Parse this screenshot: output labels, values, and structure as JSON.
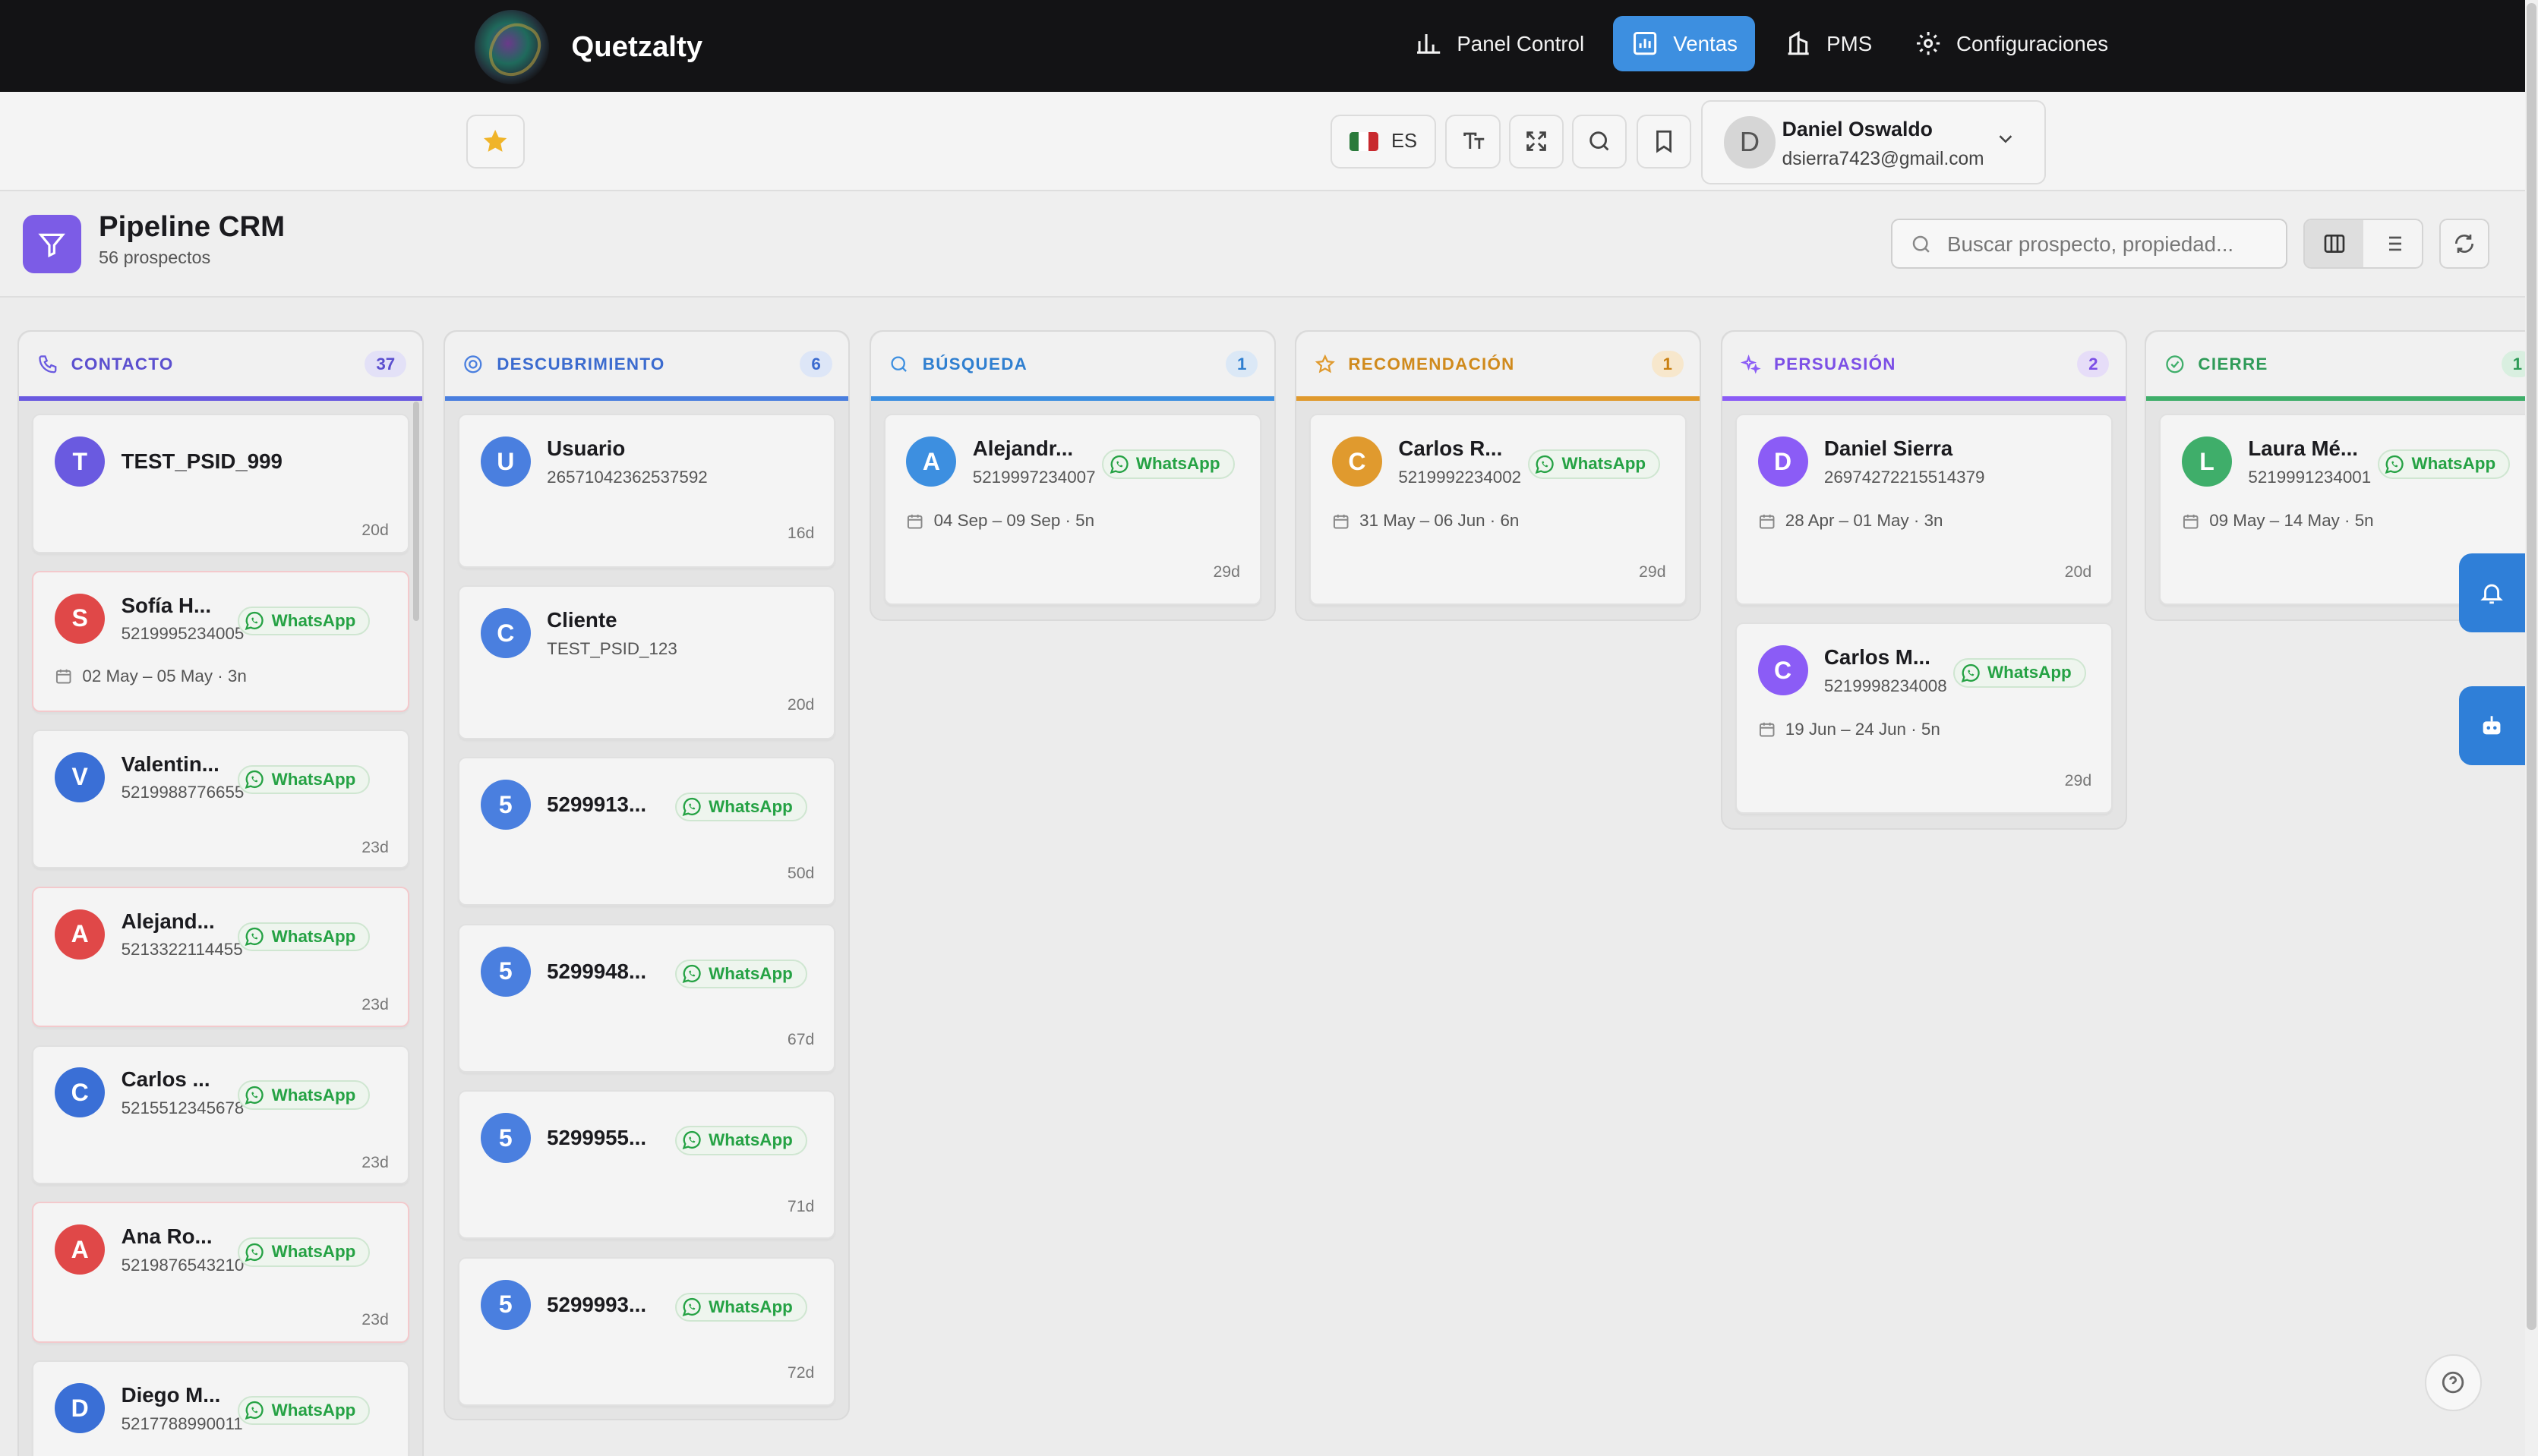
{
  "app": {
    "name": "Quetzalty"
  },
  "nav": [
    {
      "label": "Panel Control",
      "icon": "bar-chart-icon",
      "active": false
    },
    {
      "label": "Ventas",
      "icon": "sales-chart-icon",
      "active": true
    },
    {
      "label": "PMS",
      "icon": "building-icon",
      "active": false
    },
    {
      "label": "Configuraciones",
      "icon": "gear-icon",
      "active": false
    }
  ],
  "toolbar": {
    "language": "ES"
  },
  "user": {
    "initial": "D",
    "name": "Daniel Oswaldo",
    "email": "dsierra7423@gmail.com"
  },
  "page": {
    "title": "Pipeline CRM",
    "subtitle": "56 prospectos"
  },
  "search": {
    "placeholder": "Buscar prospecto, propiedad...",
    "value": ""
  },
  "colors": {
    "accent": "#3d8fe0",
    "brand": "#7c5ce6",
    "whatsapp": "#25a244"
  },
  "columns": [
    {
      "title": "CONTACTO",
      "count": "37",
      "color": "#6a5ae0",
      "icon": "phone-icon"
    },
    {
      "title": "DESCUBRIMIENTO",
      "count": "6",
      "color": "#4a7fdf",
      "icon": "target-icon"
    },
    {
      "title": "BÚSQUEDA",
      "count": "1",
      "color": "#3d8fe0",
      "icon": "search-icon"
    },
    {
      "title": "RECOMENDACIÓN",
      "count": "1",
      "color": "#e09a2e",
      "icon": "star-icon"
    },
    {
      "title": "PERSUASIÓN",
      "count": "2",
      "color": "#8b5cf6",
      "icon": "sparkle-icon"
    },
    {
      "title": "CIERRE",
      "count": "1",
      "color": "#3fae6a",
      "icon": "check-circle-icon"
    }
  ],
  "cards": {
    "contacto": [
      {
        "initial": "T",
        "name": "TEST_PSID_999",
        "age": "20d"
      },
      {
        "initial": "S",
        "name": "Sofía H...",
        "phone": "5219995234005",
        "whatsapp": "WhatsApp",
        "dates": "02 May – 05 May · 3n"
      },
      {
        "initial": "V",
        "name": "Valentin...",
        "phone": "5219988776655",
        "whatsapp": "WhatsApp",
        "age": "23d"
      },
      {
        "initial": "A",
        "name": "Alejand...",
        "phone": "5213322114455",
        "whatsapp": "WhatsApp",
        "age": "23d"
      },
      {
        "initial": "C",
        "name": "Carlos ...",
        "phone": "5215512345678",
        "whatsapp": "WhatsApp",
        "age": "23d"
      },
      {
        "initial": "A",
        "name": "Ana Ro...",
        "phone": "5219876543210",
        "whatsapp": "WhatsApp",
        "age": "23d"
      },
      {
        "initial": "D",
        "name": "Diego M...",
        "phone": "5217788990011",
        "whatsapp": "WhatsApp"
      }
    ],
    "descubrimiento": [
      {
        "initial": "U",
        "name": "Usuario",
        "sub": "26571042362537592",
        "age": "16d"
      },
      {
        "initial": "C",
        "name": "Cliente",
        "sub": "TEST_PSID_123",
        "age": "20d"
      },
      {
        "initial": "5",
        "name": "5299913...",
        "whatsapp": "WhatsApp",
        "age": "50d"
      },
      {
        "initial": "5",
        "name": "5299948...",
        "whatsapp": "WhatsApp",
        "age": "67d"
      },
      {
        "initial": "5",
        "name": "5299955...",
        "whatsapp": "WhatsApp",
        "age": "71d"
      },
      {
        "initial": "5",
        "name": "5299993...",
        "whatsapp": "WhatsApp",
        "age": "72d"
      }
    ],
    "busqueda": [
      {
        "initial": "A",
        "name": "Alejandr...",
        "phone": "5219997234007",
        "whatsapp": "WhatsApp",
        "dates": "04 Sep – 09 Sep · 5n",
        "age": "29d"
      }
    ],
    "recomendacion": [
      {
        "initial": "C",
        "name": "Carlos R...",
        "phone": "5219992234002",
        "whatsapp": "WhatsApp",
        "dates": "31 May – 06 Jun · 6n",
        "age": "29d"
      }
    ],
    "persuasion": [
      {
        "initial": "D",
        "name": "Daniel Sierra",
        "sub": "26974272215514379",
        "dates": "28 Apr – 01 May · 3n",
        "age": "20d"
      },
      {
        "initial": "C",
        "name": "Carlos M...",
        "phone": "5219998234008",
        "whatsapp": "WhatsApp",
        "dates": "19 Jun – 24 Jun · 5n",
        "age": "29d"
      }
    ],
    "cierre": [
      {
        "initial": "L",
        "name": "Laura Mé...",
        "phone": "5219991234001",
        "whatsapp": "WhatsApp",
        "dates": "09 May – 14 May · 5n"
      }
    ]
  }
}
